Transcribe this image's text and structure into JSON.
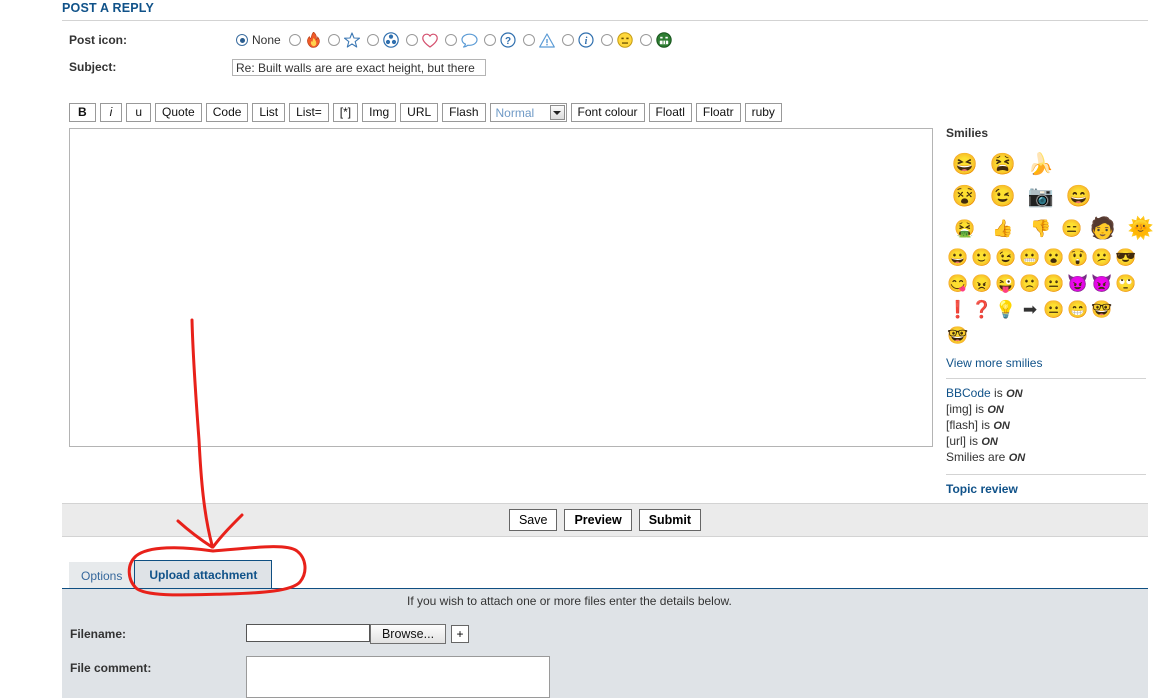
{
  "page": {
    "title": "POST A REPLY"
  },
  "post_icon": {
    "label": "Post icon:",
    "options": [
      {
        "name": "none",
        "text": "None",
        "glyph": "",
        "selected": true
      },
      {
        "name": "fire-icon",
        "text": "",
        "glyph": "🔥",
        "selected": false
      },
      {
        "name": "star-icon",
        "text": "",
        "glyph": "☆",
        "selected": false
      },
      {
        "name": "radiation-icon",
        "text": "",
        "glyph": "☢",
        "selected": false
      },
      {
        "name": "heart-icon",
        "text": "",
        "glyph": "♡",
        "selected": false
      },
      {
        "name": "speech-bubble-icon",
        "text": "",
        "glyph": "🗩",
        "selected": false
      },
      {
        "name": "question-mark-icon",
        "text": "",
        "glyph": "?",
        "selected": false
      },
      {
        "name": "warning-triangle-icon",
        "text": "",
        "glyph": "⚠",
        "selected": false
      },
      {
        "name": "info-icon",
        "text": "",
        "glyph": "i",
        "selected": false
      },
      {
        "name": "yellow-smiley-icon",
        "text": "",
        "glyph": "😕",
        "selected": false
      },
      {
        "name": "green-smiley-icon",
        "text": "",
        "glyph": "😁",
        "selected": false
      }
    ]
  },
  "subject": {
    "label": "Subject:",
    "value": "Re: Built walls are are exact height, but there",
    "placeholder": ""
  },
  "bbcode_toolbar": {
    "buttons": [
      "B",
      "i",
      "u",
      "Quote",
      "Code",
      "List",
      "List=",
      "[*]",
      "Img",
      "URL",
      "Flash"
    ],
    "font_size_selected": "Normal",
    "buttons_after": [
      "Font colour",
      "Floatl",
      "Floatr",
      "ruby"
    ]
  },
  "message": {
    "value": "",
    "placeholder": ""
  },
  "smilies": {
    "title": "Smilies",
    "rows": [
      [
        {
          "name": "smiley-laugh-hands",
          "glyph": "😆",
          "size": "big"
        },
        {
          "name": "smiley-shout-stars",
          "glyph": "😫",
          "size": "big"
        },
        {
          "name": "smiley-banana-dance",
          "glyph": "🍌",
          "size": "big"
        }
      ],
      [
        {
          "name": "smiley-girl-shout",
          "glyph": "😵",
          "size": "big"
        },
        {
          "name": "smiley-wink",
          "glyph": "😉",
          "size": "big"
        },
        {
          "name": "smiley-camera",
          "glyph": "📷",
          "size": "big"
        },
        {
          "name": "smiley-happy-hands",
          "glyph": "😄",
          "size": "big"
        }
      ],
      [
        {
          "name": "smiley-puke",
          "glyph": "🤮",
          "size": "big"
        },
        {
          "name": "smiley-thumbs-up",
          "glyph": "👍",
          "size": "big"
        },
        {
          "name": "smiley-thumbs-down",
          "glyph": "👎",
          "size": "big"
        },
        {
          "name": "smiley-flat",
          "glyph": "😑",
          "size": "big"
        },
        {
          "name": "smiley-afro",
          "glyph": "🧑",
          "size": "big"
        },
        {
          "name": "smiley-sun",
          "glyph": "🌞",
          "size": "big"
        }
      ],
      [
        {
          "name": "smiley-grin",
          "glyph": "😀",
          "size": "normal"
        },
        {
          "name": "smiley-smile",
          "glyph": "🙂",
          "size": "normal"
        },
        {
          "name": "smiley-wink2",
          "glyph": "😉",
          "size": "normal"
        },
        {
          "name": "smiley-teeth",
          "glyph": "😬",
          "size": "normal"
        },
        {
          "name": "smiley-surprised",
          "glyph": "😮",
          "size": "normal"
        },
        {
          "name": "smiley-shocked",
          "glyph": "😲",
          "size": "normal"
        },
        {
          "name": "smiley-confused",
          "glyph": "😕",
          "size": "normal"
        },
        {
          "name": "smiley-cool",
          "glyph": "😎",
          "size": "normal"
        }
      ],
      [
        {
          "name": "smiley-tongue",
          "glyph": "😋",
          "size": "normal"
        },
        {
          "name": "smiley-mad",
          "glyph": "😠",
          "size": "normal"
        },
        {
          "name": "smiley-razz",
          "glyph": "😜",
          "size": "normal"
        },
        {
          "name": "smiley-sad",
          "glyph": "🙁",
          "size": "normal"
        },
        {
          "name": "smiley-neutral",
          "glyph": "😐",
          "size": "normal"
        },
        {
          "name": "smiley-evil",
          "glyph": "😈",
          "size": "normal"
        },
        {
          "name": "smiley-twisted",
          "glyph": "👿",
          "size": "normal"
        },
        {
          "name": "smiley-rolleyes",
          "glyph": "🙄",
          "size": "normal"
        }
      ],
      [
        {
          "name": "smiley-exclaim",
          "glyph": "❗",
          "size": "normal"
        },
        {
          "name": "smiley-question",
          "glyph": "❓",
          "size": "normal"
        },
        {
          "name": "smiley-idea",
          "glyph": "💡",
          "size": "normal"
        },
        {
          "name": "smiley-arrow",
          "glyph": "➡",
          "size": "normal"
        },
        {
          "name": "smiley-neutral2",
          "glyph": "😐",
          "size": "normal"
        },
        {
          "name": "smiley-mrgreen",
          "glyph": "😁",
          "size": "normal"
        },
        {
          "name": "smiley-geek",
          "glyph": "🤓",
          "size": "normal"
        }
      ],
      [
        {
          "name": "smiley-ugeek",
          "glyph": "🤓",
          "size": "normal"
        }
      ]
    ],
    "view_more": "View more smilies",
    "status": [
      {
        "code": "BBCode",
        "is": "is",
        "state": "ON",
        "link": true
      },
      {
        "code": "[img]",
        "is": "is",
        "state": "ON",
        "link": false
      },
      {
        "code": "[flash]",
        "is": "is",
        "state": "ON",
        "link": false
      },
      {
        "code": "[url]",
        "is": "is",
        "state": "ON",
        "link": false
      },
      {
        "code": "Smilies",
        "is": "are",
        "state": "ON",
        "link": false
      }
    ],
    "topic_review": "Topic review"
  },
  "submit_bar": {
    "save": "Save",
    "preview": "Preview",
    "submit": "Submit"
  },
  "tabs": [
    {
      "name": "tab-options",
      "label": "Options",
      "active": false
    },
    {
      "name": "tab-upload-attachment",
      "label": "Upload attachment",
      "active": true
    }
  ],
  "attachment": {
    "note": "If you wish to attach one or more files enter the details below.",
    "filename_label": "Filename:",
    "filename_value": "",
    "browse_label": "Browse...",
    "add_label": "+",
    "filecomment_label": "File comment:",
    "filecomment_value": ""
  },
  "annotation": {
    "color": "#e8211a",
    "shapes": [
      "arrow-pointing-down",
      "oval-around-upload-attachment-tab"
    ]
  },
  "colors": {
    "accent_blue": "#105289",
    "panel_bg": "#dfe3e7",
    "bar_bg": "#ebebeb",
    "annotation_red": "#e8211a"
  }
}
